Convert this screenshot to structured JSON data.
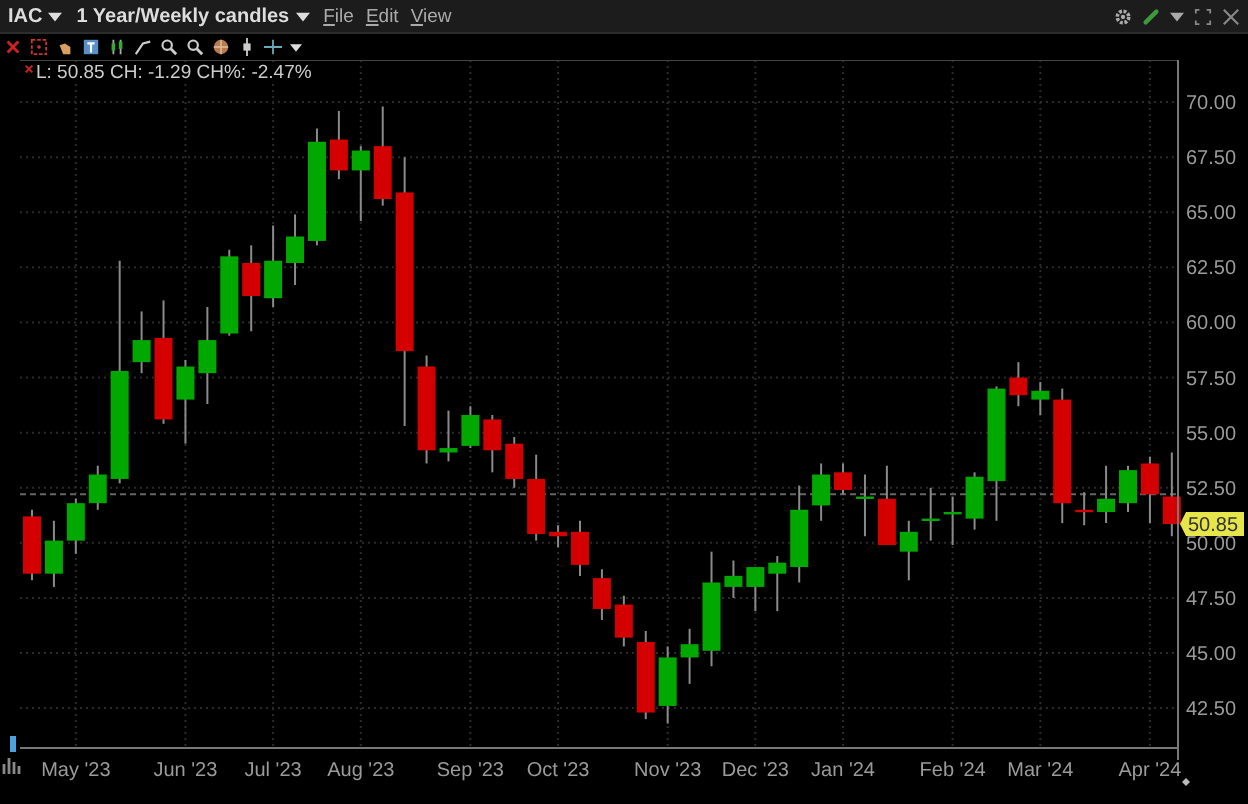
{
  "header": {
    "symbol": "IAC",
    "period": "1 Year/Weekly candles",
    "menus": [
      "File",
      "Edit",
      "View"
    ]
  },
  "chart": {
    "legend": "L: 50.85 CH: -1.29 CH%: -2.47%",
    "last_price_label": "50.85",
    "chart_data": {
      "type": "candlestick",
      "categories": [
        null,
        null,
        "May '23",
        null,
        null,
        null,
        null,
        "Jun '23",
        null,
        null,
        null,
        "Jul '23",
        null,
        null,
        null,
        "Aug '23",
        null,
        null,
        null,
        null,
        "Sep '23",
        null,
        null,
        null,
        "Oct '23",
        null,
        null,
        null,
        null,
        "Nov '23",
        null,
        null,
        null,
        "Dec '23",
        null,
        null,
        null,
        "Jan '24",
        null,
        null,
        null,
        null,
        "Feb '24",
        null,
        null,
        null,
        "Mar '24",
        null,
        null,
        null,
        null,
        "Apr '24",
        null
      ],
      "ohlc": [
        [
          51.2,
          51.5,
          48.3,
          48.6
        ],
        [
          48.6,
          51.0,
          48.0,
          50.1
        ],
        [
          50.1,
          52.0,
          49.5,
          51.8
        ],
        [
          51.8,
          53.5,
          51.5,
          53.1
        ],
        [
          52.9,
          62.8,
          52.7,
          57.8
        ],
        [
          58.2,
          60.5,
          57.7,
          59.2
        ],
        [
          59.3,
          61.0,
          55.4,
          55.6
        ],
        [
          56.5,
          58.3,
          54.5,
          58.0
        ],
        [
          57.7,
          60.7,
          56.3,
          59.2
        ],
        [
          59.5,
          63.3,
          59.4,
          63.0
        ],
        [
          62.7,
          63.5,
          59.6,
          61.2
        ],
        [
          61.1,
          64.4,
          60.7,
          62.8
        ],
        [
          62.7,
          64.9,
          61.7,
          63.9
        ],
        [
          63.7,
          68.8,
          63.5,
          68.2
        ],
        [
          68.3,
          69.6,
          66.5,
          66.9
        ],
        [
          66.9,
          68.0,
          64.6,
          67.8
        ],
        [
          68.0,
          69.8,
          65.3,
          65.6
        ],
        [
          65.9,
          67.5,
          55.3,
          58.7
        ],
        [
          58.0,
          58.5,
          53.6,
          54.2
        ],
        [
          54.1,
          56.0,
          53.7,
          54.3
        ],
        [
          54.4,
          56.2,
          54.3,
          55.8
        ],
        [
          55.6,
          55.8,
          53.2,
          54.2
        ],
        [
          54.5,
          54.8,
          52.5,
          52.9
        ],
        [
          52.9,
          54.0,
          50.1,
          50.4
        ],
        [
          50.5,
          50.8,
          49.8,
          50.3
        ],
        [
          50.5,
          51.0,
          48.5,
          49.0
        ],
        [
          48.4,
          48.8,
          46.5,
          47.0
        ],
        [
          47.2,
          47.6,
          45.3,
          45.7
        ],
        [
          45.5,
          46.0,
          42.0,
          42.3
        ],
        [
          42.6,
          45.3,
          41.8,
          44.8
        ],
        [
          44.8,
          46.1,
          43.6,
          45.4
        ],
        [
          45.1,
          49.6,
          44.4,
          48.2
        ],
        [
          48.0,
          49.2,
          47.5,
          48.5
        ],
        [
          48.0,
          48.9,
          46.9,
          48.9
        ],
        [
          48.6,
          49.4,
          46.9,
          49.1
        ],
        [
          48.9,
          52.6,
          48.2,
          51.5
        ],
        [
          51.7,
          53.6,
          51.0,
          53.1
        ],
        [
          53.2,
          53.6,
          52.2,
          52.4
        ],
        [
          52.0,
          53.1,
          50.3,
          52.1
        ],
        [
          52.0,
          53.5,
          49.9,
          49.9
        ],
        [
          49.6,
          51.0,
          48.3,
          50.5
        ],
        [
          51.0,
          52.5,
          50.1,
          51.1
        ],
        [
          51.3,
          52.1,
          49.9,
          51.4
        ],
        [
          51.1,
          53.2,
          50.6,
          53.0
        ],
        [
          52.8,
          57.1,
          51.0,
          57.0
        ],
        [
          57.5,
          58.2,
          56.2,
          56.7
        ],
        [
          56.5,
          57.3,
          55.8,
          56.9
        ],
        [
          56.5,
          57.0,
          50.9,
          51.8
        ],
        [
          51.5,
          52.3,
          50.8,
          51.4
        ],
        [
          51.4,
          53.5,
          50.9,
          52.0
        ],
        [
          51.8,
          53.5,
          51.4,
          53.3
        ],
        [
          53.6,
          53.9,
          50.9,
          52.2
        ],
        [
          52.1,
          54.1,
          50.3,
          50.85
        ]
      ],
      "ylim": [
        40.69,
        71.91
      ],
      "yticks": [
        {
          "value": 70,
          "label": "70.00"
        },
        {
          "value": 67.5,
          "label": "67.50"
        },
        {
          "value": 65,
          "label": "65.00"
        },
        {
          "value": 62.5,
          "label": "62.50"
        },
        {
          "value": 60,
          "label": "60.00"
        },
        {
          "value": 57.5,
          "label": "57.50"
        },
        {
          "value": 55,
          "label": "55.00"
        },
        {
          "value": 52.5,
          "label": "52.50"
        },
        {
          "value": 50,
          "label": "50.00"
        },
        {
          "value": 47.5,
          "label": "47.50"
        },
        {
          "value": 45,
          "label": "45.00"
        },
        {
          "value": 42.5,
          "label": "42.50"
        }
      ],
      "grid": true,
      "ref_lines": [
        {
          "axis": "y",
          "value": 52.2
        }
      ]
    }
  }
}
